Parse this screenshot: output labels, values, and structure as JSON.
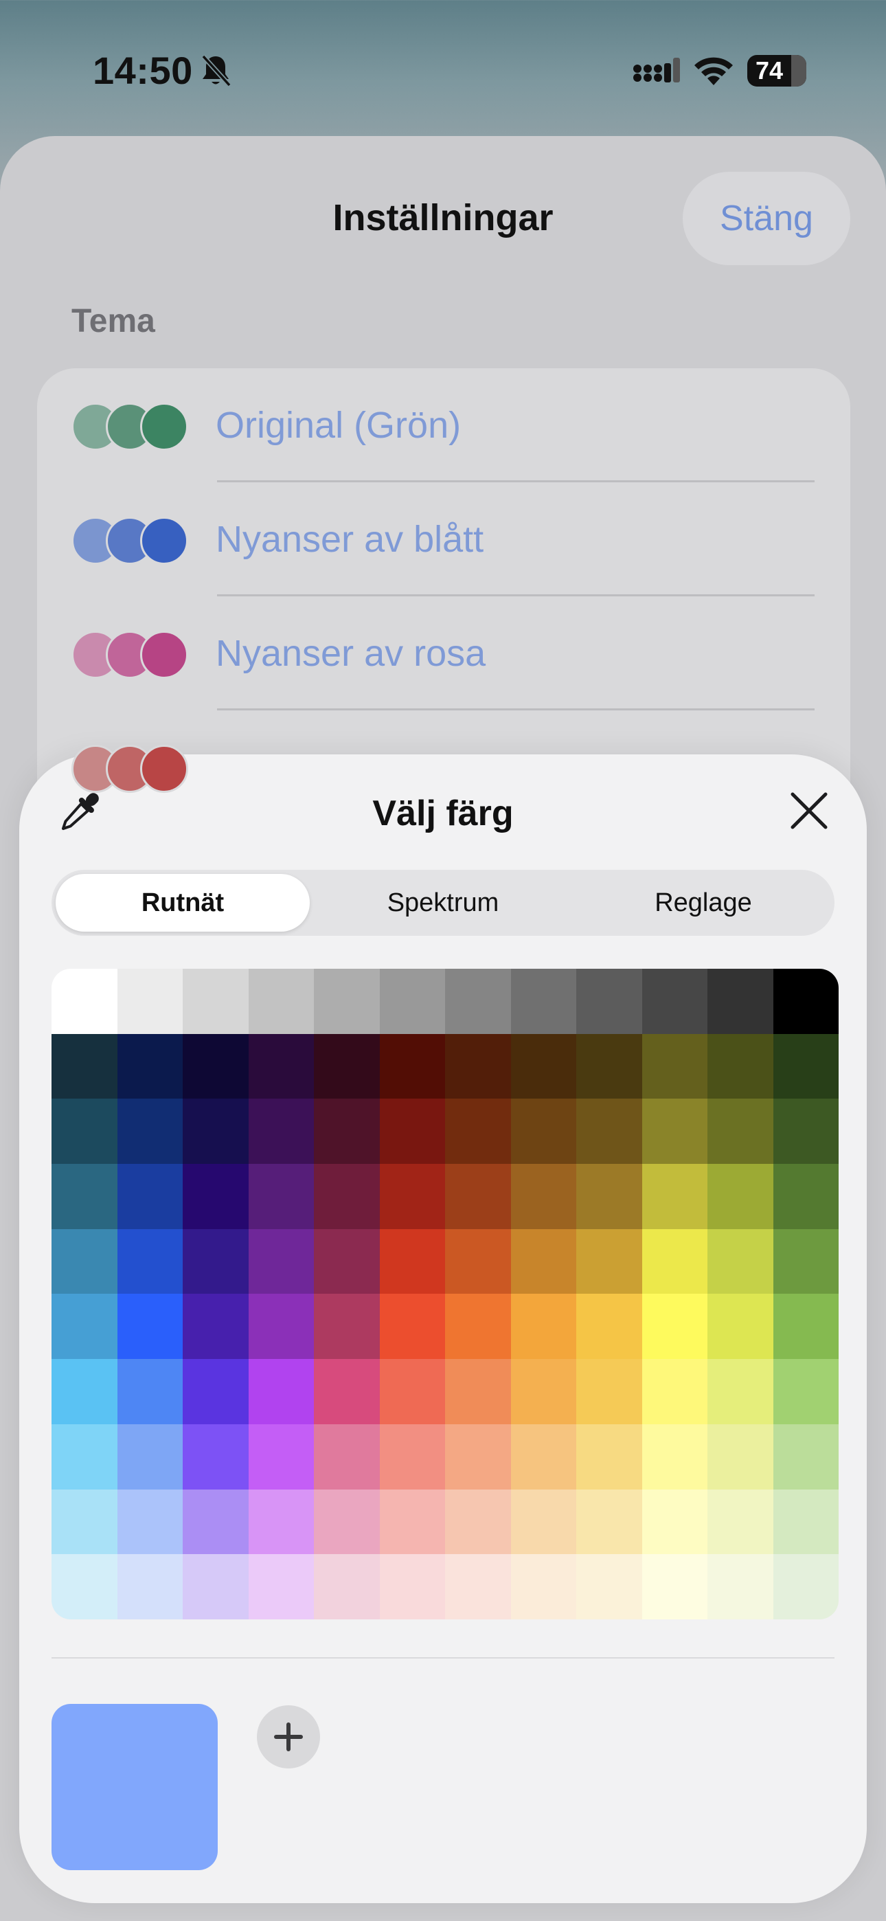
{
  "status": {
    "time": "14:50",
    "battery": "74"
  },
  "settings": {
    "title": "Inställningar",
    "close_label": "Stäng",
    "section": "Tema",
    "themes": [
      {
        "label": "Original (Grön)",
        "colors": [
          "#7fa897",
          "#5a9178",
          "#3c8462"
        ]
      },
      {
        "label": "Nyanser av blått",
        "colors": [
          "#7b95cf",
          "#5878c5",
          "#3760c0"
        ]
      },
      {
        "label": "Nyanser av rosa",
        "colors": [
          "#c98aad",
          "#c06599",
          "#b64484"
        ]
      },
      {
        "label": "",
        "colors": [
          "#c68686",
          "#bf6565",
          "#b84545"
        ]
      }
    ]
  },
  "picker": {
    "title": "Välj färg",
    "tabs": [
      {
        "label": "Rutnät",
        "active": true
      },
      {
        "label": "Spektrum",
        "active": false
      },
      {
        "label": "Reglage",
        "active": false
      }
    ],
    "selected_color": "#81a7fc",
    "grid": [
      [
        "#ffffff",
        "#ebebeb",
        "#d6d6d6",
        "#c2c2c2",
        "#adadad",
        "#999999",
        "#858585",
        "#707070",
        "#5c5c5c",
        "#474747",
        "#333333",
        "#000000"
      ],
      [
        "#16303e",
        "#0b1a4d",
        "#0e0834",
        "#2a0b3b",
        "#330a1a",
        "#520d05",
        "#521e09",
        "#4a2c0b",
        "#4a3a10",
        "#64601d",
        "#4b5118",
        "#283f18"
      ],
      [
        "#1c4a5e",
        "#112d73",
        "#160f4f",
        "#3c1157",
        "#4f1329",
        "#791710",
        "#722c0e",
        "#6e4413",
        "#6f5519",
        "#8a8429",
        "#6b7123",
        "#3d5923"
      ],
      [
        "#2a6781",
        "#1a3da0",
        "#26086f",
        "#561e79",
        "#6f1d3b",
        "#a12417",
        "#9c3f19",
        "#9b6320",
        "#9c7a27",
        "#c2bc3b",
        "#9caa34",
        "#547a30"
      ],
      [
        "#3a88b1",
        "#2350cf",
        "#331a8c",
        "#6f2799",
        "#8b2a50",
        "#d0371f",
        "#cb5823",
        "#c8852b",
        "#cba033",
        "#ece84b",
        "#c5d148",
        "#6d9a3f"
      ],
      [
        "#469fd4",
        "#2a5ffb",
        "#4720ad",
        "#8b30b8",
        "#ad3a60",
        "#ec4e2e",
        "#ef7530",
        "#f3a63b",
        "#f5c546",
        "#fefa5d",
        "#dde652",
        "#85ba50"
      ],
      [
        "#5ac2f3",
        "#4e86f4",
        "#5a34e0",
        "#b143ef",
        "#d74b7d",
        "#ef6a54",
        "#f08c58",
        "#f4b050",
        "#f5ca56",
        "#fef87a",
        "#e5ee7b",
        "#a1d171"
      ],
      [
        "#7fd4f7",
        "#7ea6f5",
        "#7d52f5",
        "#c45ef6",
        "#e07a9d",
        "#f28f82",
        "#f4a884",
        "#f6c47f",
        "#f7da82",
        "#fefa9e",
        "#ebf09e",
        "#bbdd9a"
      ],
      [
        "#a9e1f7",
        "#abc3fa",
        "#ab8ef4",
        "#d894f6",
        "#eaa6c0",
        "#f5b5b0",
        "#f6c6b0",
        "#f8d9ab",
        "#f9e6ab",
        "#fefcc2",
        "#f1f5c2",
        "#d4e9c0"
      ],
      [
        "#d3eef9",
        "#d4e0fb",
        "#d6c9f8",
        "#ebcaf9",
        "#f2d2dd",
        "#f9dadb",
        "#fae3dc",
        "#fbecd9",
        "#fbf2d9",
        "#fefde1",
        "#f5f8e0",
        "#e4f0dc"
      ]
    ]
  }
}
